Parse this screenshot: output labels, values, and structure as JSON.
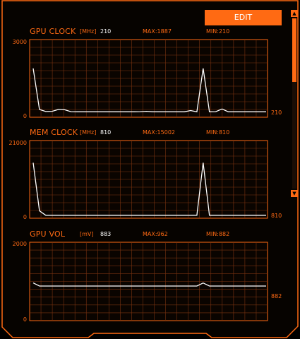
{
  "toolbar": {
    "edit_label": "EDIT"
  },
  "charts": [
    {
      "title": "GPU CLOCK",
      "unit": "[MHz]",
      "current": "210",
      "max": "MAX:1887",
      "min": "MIN:210",
      "ymax_label": "3000",
      "ymin_label": "0",
      "last_label": "210"
    },
    {
      "title": "MEM CLOCK",
      "unit": "[MHz]",
      "current": "810",
      "max": "MAX:15002",
      "min": "MIN:810",
      "ymax_label": "21000",
      "ymin_label": "0",
      "last_label": "810"
    },
    {
      "title": "GPU VOL",
      "unit": "[mV]",
      "current": "883",
      "max": "MAX:962",
      "min": "MIN:882",
      "ymax_label": "2000",
      "ymin_label": "0",
      "last_label": "882"
    }
  ],
  "chart_data": [
    {
      "type": "line",
      "ylim": [
        0,
        3000
      ],
      "values": [
        1887,
        300,
        220,
        230,
        300,
        290,
        215,
        210,
        210,
        210,
        210,
        210,
        210,
        210,
        210,
        210,
        210,
        215,
        230,
        210,
        210,
        210,
        210,
        210,
        210,
        260,
        210,
        1887,
        210,
        215,
        320,
        210,
        210,
        210,
        210,
        210,
        210,
        210
      ]
    },
    {
      "type": "line",
      "ylim": [
        0,
        21000
      ],
      "values": [
        15002,
        2000,
        810,
        810,
        810,
        810,
        810,
        810,
        810,
        810,
        810,
        810,
        810,
        810,
        810,
        810,
        810,
        810,
        810,
        810,
        810,
        810,
        810,
        810,
        810,
        810,
        810,
        15002,
        810,
        810,
        810,
        810,
        810,
        810,
        810,
        810,
        810,
        810
      ]
    },
    {
      "type": "line",
      "ylim": [
        0,
        2000
      ],
      "values": [
        962,
        882,
        882,
        882,
        882,
        882,
        882,
        882,
        882,
        882,
        882,
        882,
        882,
        882,
        882,
        882,
        882,
        882,
        882,
        882,
        882,
        882,
        882,
        882,
        882,
        882,
        882,
        960,
        882,
        882,
        882,
        882,
        882,
        882,
        882,
        882,
        882,
        882
      ]
    }
  ]
}
